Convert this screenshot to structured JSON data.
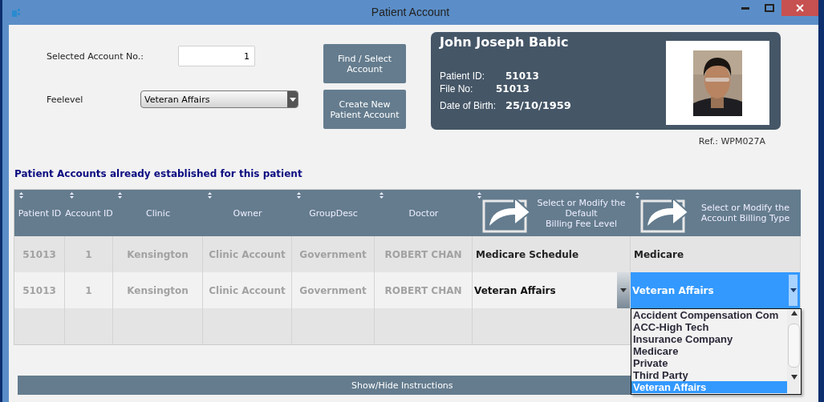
{
  "window": {
    "title": "Patient Account"
  },
  "form": {
    "account_no": {
      "label": "Selected Account No.:",
      "value": "1"
    },
    "feelevel": {
      "label": "Feelevel",
      "value": "Veteran Affairs"
    }
  },
  "buttons": [
    {
      "label": "Find / Select Account"
    },
    {
      "label": "Create New Patient Account"
    }
  ],
  "patient_card": {
    "name": "John Joseph Babic",
    "fields": [
      {
        "label": "Patient ID:",
        "value": "51013"
      },
      {
        "label": "File No:",
        "value": "51013"
      },
      {
        "label": "Date of Birth:",
        "value": "25/10/1959"
      }
    ]
  },
  "ref": "Ref.: WPM027A",
  "section_title": "Patient Accounts already established for this patient",
  "table": {
    "columns": [
      {
        "label": "Patient ID",
        "kind": "text"
      },
      {
        "label": "Account ID",
        "kind": "text"
      },
      {
        "label": "Clinic",
        "kind": "text"
      },
      {
        "label": "Owner",
        "kind": "text"
      },
      {
        "label": "GroupDesc",
        "kind": "text"
      },
      {
        "label": "Doctor",
        "kind": "text"
      },
      {
        "label": "Select or Modify the Default\nBilling Fee Level",
        "kind": "action"
      },
      {
        "label": "Select or Modify the Account Billing Type",
        "kind": "action"
      }
    ],
    "rows": [
      {
        "cells": [
          "51013",
          "1",
          "Kensington",
          "Clinic Account",
          "Government",
          "ROBERT CHAN",
          "Medicare Schedule",
          "Medicare"
        ],
        "editing": false
      },
      {
        "cells": [
          "51013",
          "1",
          "Kensington",
          "Clinic Account",
          "Government",
          "ROBERT CHAN",
          "Veteran Affairs",
          "Veteran Affairs"
        ],
        "editing": true
      }
    ]
  },
  "dropdown": {
    "expanded": true,
    "options": [
      {
        "label": "Accident Compensation Com",
        "selected": false
      },
      {
        "label": "ACC-High Tech",
        "selected": false
      },
      {
        "label": "Insurance Company",
        "selected": false
      },
      {
        "label": "Medicare",
        "selected": false
      },
      {
        "label": "Private",
        "selected": false
      },
      {
        "label": "Third Party",
        "selected": false
      },
      {
        "label": "Veteran Affairs",
        "selected": true
      }
    ]
  },
  "instructions_button": {
    "label": "Show/Hide Instructions"
  }
}
